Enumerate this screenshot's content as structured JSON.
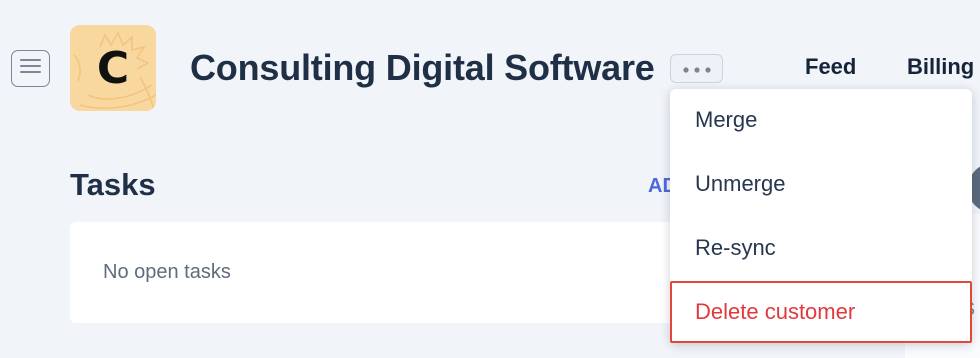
{
  "header": {
    "menu_icon": "hamburger-menu-icon",
    "avatar_letter": "C",
    "title": "Consulting Digital Software",
    "more_icon": "ellipsis-icon"
  },
  "nav_tabs": [
    {
      "label": "Feed"
    },
    {
      "label": "Billing"
    }
  ],
  "tasks": {
    "heading": "Tasks",
    "add_label": "AD",
    "empty_text": "No open tasks"
  },
  "right_edge_text": "S",
  "dropdown": {
    "items": [
      {
        "label": "Merge"
      },
      {
        "label": "Unmerge"
      },
      {
        "label": "Re-sync"
      },
      {
        "label": "Delete customer",
        "color": "#e03a3e"
      }
    ]
  },
  "colors": {
    "background": "#f1f4f9",
    "avatar": "#f9d89f",
    "accent_link": "#4d68d9",
    "danger": "#e03a3e"
  }
}
